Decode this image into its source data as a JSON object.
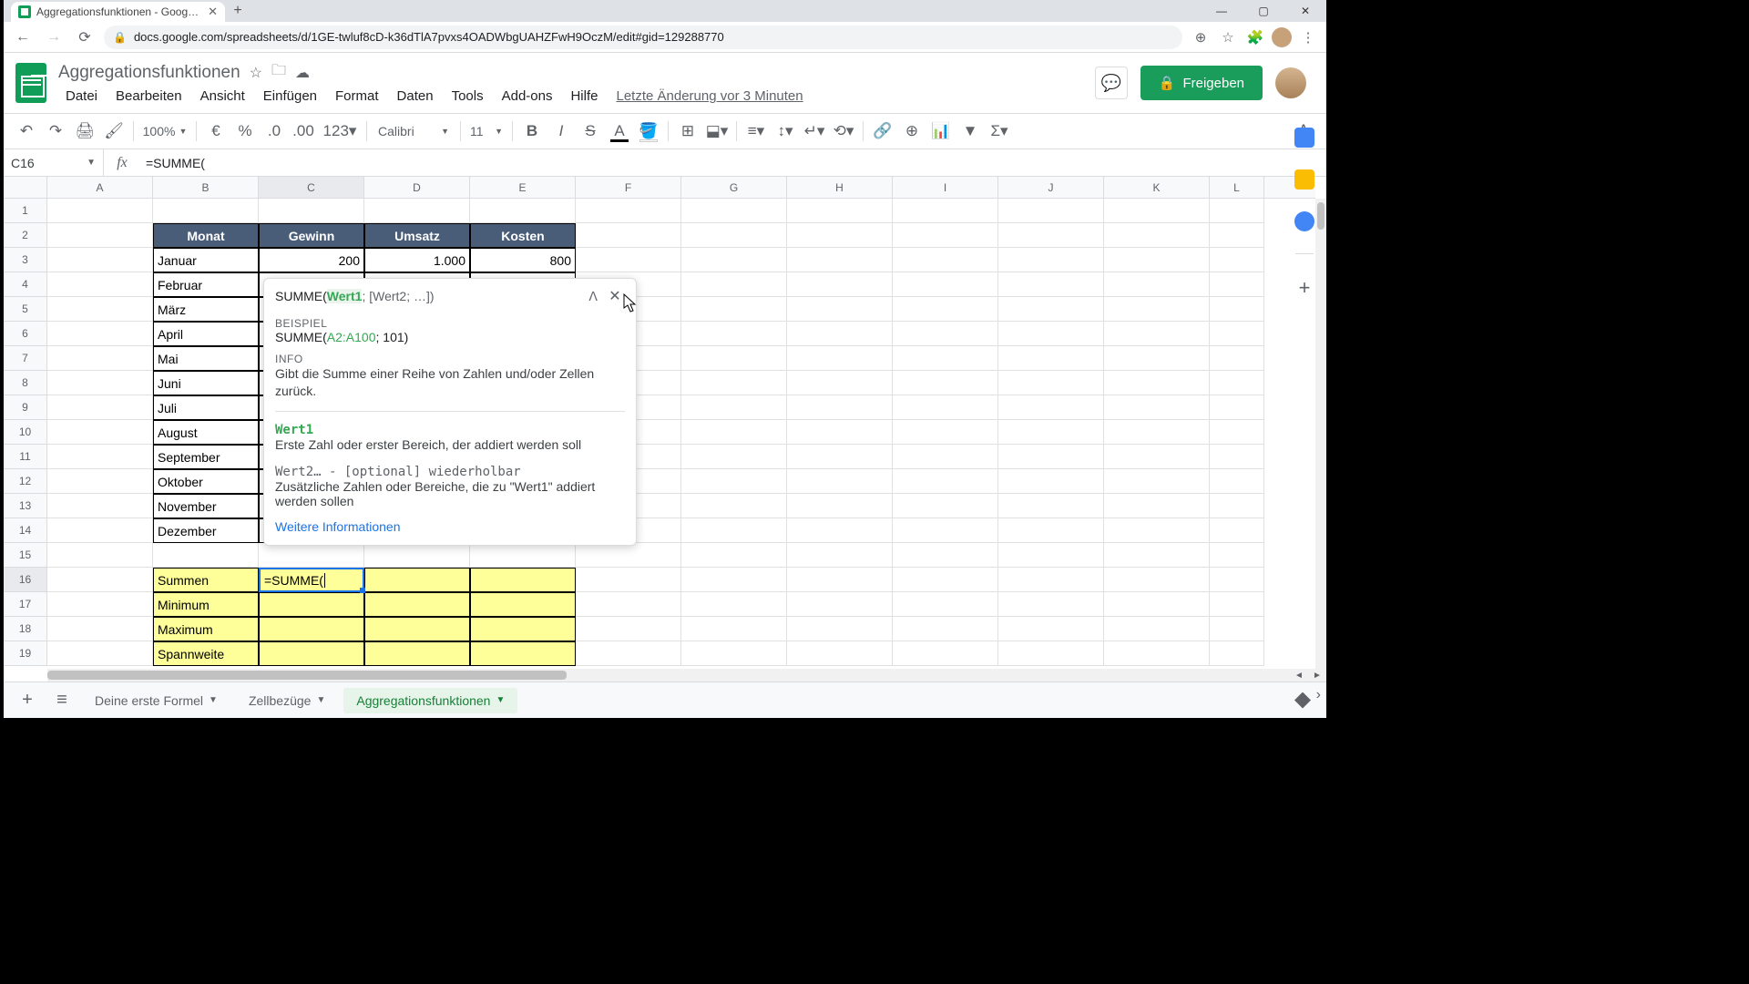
{
  "browser": {
    "tab_title": "Aggregationsfunktionen - Goog…",
    "url": "docs.google.com/spreadsheets/d/1GE-twluf8cD-k36dTlA7pvxs4OADWbgUAHZFwH9OczM/edit#gid=129288770"
  },
  "app": {
    "title": "Aggregationsfunktionen",
    "menus": [
      "Datei",
      "Bearbeiten",
      "Ansicht",
      "Einfügen",
      "Format",
      "Daten",
      "Tools",
      "Add-ons",
      "Hilfe"
    ],
    "last_edit": "Letzte Änderung vor 3 Minuten",
    "share": "Freigeben"
  },
  "toolbar": {
    "zoom": "100%",
    "font": "Calibri",
    "font_size": "11"
  },
  "fx": {
    "name_box": "C16",
    "formula": "=SUMME("
  },
  "columns": [
    "A",
    "B",
    "C",
    "D",
    "E",
    "F",
    "G",
    "H",
    "I",
    "J",
    "K",
    "L"
  ],
  "rows_visible": 19,
  "table": {
    "headers": [
      "Monat",
      "Gewinn",
      "Umsatz",
      "Kosten"
    ],
    "rows": [
      {
        "month": "Januar",
        "gewinn": "200",
        "umsatz": "1.000",
        "kosten": "800"
      },
      {
        "month": "Februar"
      },
      {
        "month": "März"
      },
      {
        "month": "April"
      },
      {
        "month": "Mai"
      },
      {
        "month": "Juni"
      },
      {
        "month": "Juli"
      },
      {
        "month": "August"
      },
      {
        "month": "September"
      },
      {
        "month": "Oktober"
      },
      {
        "month": "November"
      },
      {
        "month": "Dezember"
      }
    ],
    "summary": [
      "Summen",
      "Minimum",
      "Maximum",
      "Spannweite"
    ],
    "cell_formula": "=SUMME("
  },
  "help": {
    "sig_fn": "SUMME(",
    "sig_arg1": "Wert1",
    "sig_rest": "; [Wert2; …])",
    "example_label": "BEISPIEL",
    "example_pre": "SUMME(",
    "example_range": "A2:A100",
    "example_post": "; 101)",
    "info_label": "INFO",
    "info_text": "Gibt die Summe einer Reihe von Zahlen und/oder Zellen zurück.",
    "param1": "Wert1",
    "param1_desc": "Erste Zahl oder erster Bereich, der addiert werden soll",
    "param2": "Wert2… - [optional] wiederholbar",
    "param2_desc": "Zusätzliche Zahlen oder Bereiche, die zu \"Wert1\" addiert werden sollen",
    "link": "Weitere Informationen"
  },
  "sheets": {
    "tabs": [
      "Deine erste Formel",
      "Zellbezüge",
      "Aggregationsfunktionen"
    ],
    "active": 2
  }
}
